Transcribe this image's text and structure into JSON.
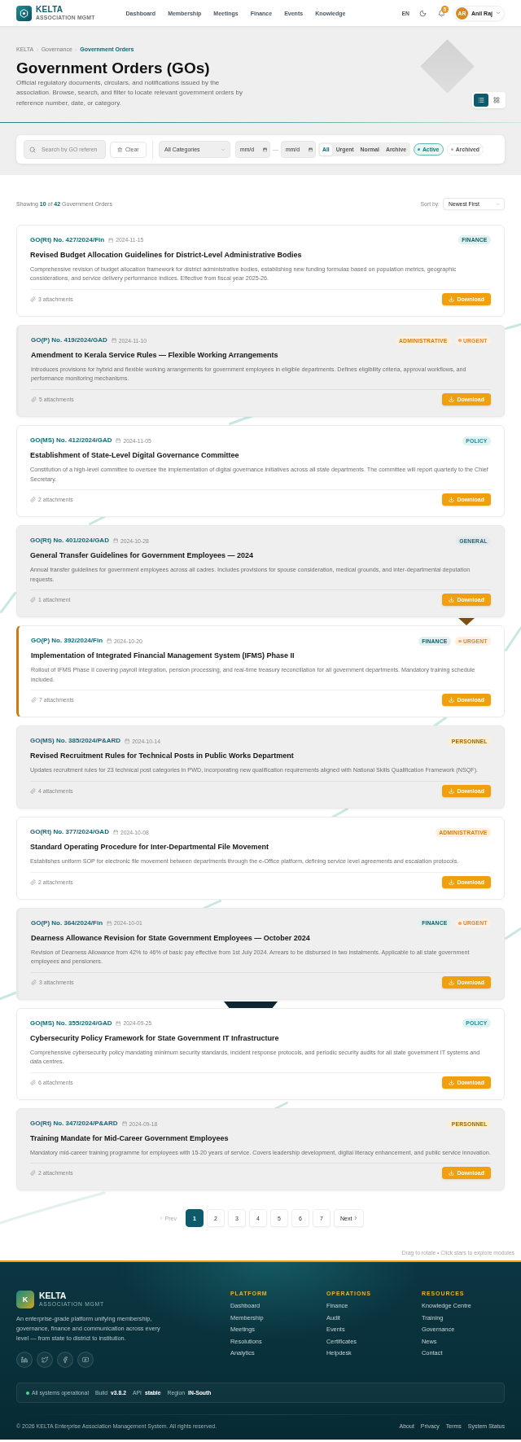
{
  "header": {
    "logo": {
      "name": "KELTA",
      "tagline": "ASSOCIATION MGMT"
    },
    "nav": [
      "Dashboard",
      "Membership",
      "Meetings",
      "Finance",
      "Events",
      "Knowledge"
    ],
    "language": "EN",
    "notifications": "5",
    "user": {
      "initials": "AR",
      "name": "Anil Raj"
    }
  },
  "hero": {
    "breadcrumb": [
      {
        "label": "KELTA",
        "current": false
      },
      {
        "label": "Governance",
        "current": false
      },
      {
        "label": "Government Orders",
        "current": true
      }
    ],
    "title": "Government Orders (GOs)",
    "description": "Official regulatory documents, circulars, and notifications issued by the association. Browse, search, and filter to locate relevant government orders by reference number, date, or category.",
    "view_modes": [
      {
        "kind": "list",
        "selected": true
      },
      {
        "kind": "grid",
        "selected": false
      }
    ]
  },
  "filters": {
    "search": {
      "placeholder": "Search by GO referen"
    },
    "clear": "Clear",
    "category": {
      "value": "All Categories"
    },
    "date_from": {
      "placeholder": "mm/d"
    },
    "date_separator": "—",
    "date_to": {
      "placeholder": "mm/d"
    },
    "priority": [
      {
        "label": "All",
        "selected": true
      },
      {
        "label": "Urgent",
        "selected": false
      },
      {
        "label": "Normal",
        "selected": false
      },
      {
        "label": "Archive",
        "selected": false
      }
    ],
    "status": [
      {
        "label": "Active",
        "selected": true
      },
      {
        "label": "Archived",
        "selected": false
      }
    ]
  },
  "results": {
    "summary": "Showing **10** of **42** Government Orders",
    "sort": {
      "label": "Sort by:",
      "value": "Newest First"
    }
  },
  "orders": [
    {
      "number": "GO(Rt) No. 427/2024/Fin",
      "date": "2024-11-15",
      "tags": [
        {
          "label": "FINANCE",
          "kind": "finance"
        }
      ],
      "title": "Revised Budget Allocation Guidelines for District-Level Administrative Bodies",
      "description": "Comprehensive revision of budget allocation framework for district administrative bodies, establishing new funding formulas based on population metrics, geographic considerations, and service delivery performance indices. Effective from fiscal year 2025-26.",
      "attachments": "3 attachments",
      "download": "Download"
    },
    {
      "number": "GO(P) No. 419/2024/GAD",
      "date": "2024-11-10",
      "tags": [
        {
          "label": "ADMINISTRATIVE",
          "kind": "administrative"
        },
        {
          "label": "URGENT",
          "kind": "urgent"
        }
      ],
      "title": "Amendment to Kerala Service Rules — Flexible Working Arrangements",
      "description": "Introduces provisions for hybrid and flexible working arrangements for government employees in eligible departments. Defines eligibility criteria, approval workflows, and performance monitoring mechanisms.",
      "attachments": "5 attachments",
      "download": "Download"
    },
    {
      "number": "GO(MS) No. 412/2024/GAD",
      "date": "2024-11-05",
      "tags": [
        {
          "label": "POLICY",
          "kind": "policy"
        }
      ],
      "title": "Establishment of State-Level Digital Governance Committee",
      "description": "Constitution of a high-level committee to oversee the implementation of digital governance initiatives across all state departments. The committee will report quarterly to the Chief Secretary.",
      "attachments": "2 attachments",
      "download": "Download"
    },
    {
      "number": "GO(Rt) No. 401/2024/GAD",
      "date": "2024-10-28",
      "tags": [
        {
          "label": "GENERAL",
          "kind": "general"
        }
      ],
      "title": "General Transfer Guidelines for Government Employees — 2024",
      "description": "Annual transfer guidelines for government employees across all cadres. Includes provisions for spouse consideration, medical grounds, and inter-departmental deputation requests.",
      "attachments": "1 attachment",
      "download": "Download"
    },
    {
      "number": "GO(P) No. 392/2024/Fin",
      "date": "2024-10-20",
      "tags": [
        {
          "label": "FINANCE",
          "kind": "finance"
        },
        {
          "label": "URGENT",
          "kind": "urgent"
        }
      ],
      "title": "Implementation of Integrated Financial Management System (IFMS) Phase II",
      "description": "Rollout of IFMS Phase II covering payroll integration, pension processing, and real-time treasury reconciliation for all government departments. Mandatory training schedule included.",
      "attachments": "7 attachments",
      "download": "Download"
    },
    {
      "number": "GO(MS) No. 385/2024/P&ARD",
      "date": "2024-10-14",
      "tags": [
        {
          "label": "PERSONNEL",
          "kind": "personnel"
        }
      ],
      "title": "Revised Recruitment Rules for Technical Posts in Public Works Department",
      "description": "Updates recruitment rules for 23 technical post categories in PWD, incorporating new qualification requirements aligned with National Skills Qualification Framework (NSQF).",
      "attachments": "4 attachments",
      "download": "Download"
    },
    {
      "number": "GO(Rt) No. 377/2024/GAD",
      "date": "2024-10-08",
      "tags": [
        {
          "label": "ADMINISTRATIVE",
          "kind": "administrative"
        }
      ],
      "title": "Standard Operating Procedure for Inter-Departmental File Movement",
      "description": "Establishes uniform SOP for electronic file movement between departments through the e-Office platform, defining service level agreements and escalation protocols.",
      "attachments": "2 attachments",
      "download": "Download"
    },
    {
      "number": "GO(P) No. 364/2024/Fin",
      "date": "2024-10-01",
      "tags": [
        {
          "label": "FINANCE",
          "kind": "finance"
        },
        {
          "label": "URGENT",
          "kind": "urgent"
        }
      ],
      "title": "Dearness Allowance Revision for State Government Employees — October 2024",
      "description": "Revision of Dearness Allowance from 42% to 46% of basic pay effective from 1st July 2024. Arrears to be disbursed in two instalments. Applicable to all state government employees and pensioners.",
      "attachments": "3 attachments",
      "download": "Download"
    },
    {
      "number": "GO(MS) No. 355/2024/GAD",
      "date": "2024-09-25",
      "tags": [
        {
          "label": "POLICY",
          "kind": "policy"
        }
      ],
      "title": "Cybersecurity Policy Framework for State Government IT Infrastructure",
      "description": "Comprehensive cybersecurity policy mandating minimum security standards, incident response protocols, and periodic security audits for all state government IT systems and data centres.",
      "attachments": "6 attachments",
      "download": "Download"
    },
    {
      "number": "GO(Rt) No. 347/2024/P&ARD",
      "date": "2024-09-18",
      "tags": [
        {
          "label": "PERSONNEL",
          "kind": "personnel"
        }
      ],
      "title": "Training Mandate for Mid-Career Government Employees",
      "description": "Mandatory mid-career training programme for employees with 15-20 years of service. Covers leadership development, digital literacy enhancement, and public service innovation.",
      "attachments": "2 attachments",
      "download": "Download"
    }
  ],
  "pagination": {
    "prev": {
      "label": "Prev",
      "disabled": true
    },
    "pages": [
      {
        "label": "1",
        "selected": true
      },
      {
        "label": "2",
        "selected": false
      },
      {
        "label": "3",
        "selected": false
      },
      {
        "label": "4",
        "selected": false
      },
      {
        "label": "5",
        "selected": false
      },
      {
        "label": "6",
        "selected": false
      },
      {
        "label": "7",
        "selected": false
      }
    ],
    "next": {
      "label": "Next",
      "disabled": false
    }
  },
  "hint": "Drag to rotate • Click stars to explore modules",
  "footer": {
    "brand": {
      "mark": "K",
      "name": "KELTA",
      "tagline": "ASSOCIATION MGMT"
    },
    "about": "An enterprise-grade platform unifying membership, governance, finance and communication across every level — from state to district to institution.",
    "social": [
      {
        "kind": "linkedin"
      },
      {
        "kind": "twitter"
      },
      {
        "kind": "facebook"
      },
      {
        "kind": "youtube"
      }
    ],
    "columns": [
      {
        "heading": "PLATFORM",
        "links": [
          "Dashboard",
          "Membership",
          "Meetings",
          "Resolutions",
          "Analytics"
        ]
      },
      {
        "heading": "OPERATIONS",
        "links": [
          "Finance",
          "Audit",
          "Events",
          "Certificates",
          "Helpdesk"
        ]
      },
      {
        "heading": "RESOURCES",
        "links": [
          "Knowledge Centre",
          "Training",
          "Governance",
          "News",
          "Contact"
        ]
      }
    ],
    "status": {
      "text": "All systems operational",
      "items": [
        {
          "label": "Build",
          "value": "v3.8.2"
        },
        {
          "label": "API",
          "value": "stable"
        },
        {
          "label": "Region",
          "value": "IN-South"
        }
      ]
    },
    "copyright": "© 2026 KELTA Enterprise Association Management System. All rights reserved.",
    "links": [
      "About",
      "Privacy",
      "Terms",
      "System Status"
    ]
  }
}
